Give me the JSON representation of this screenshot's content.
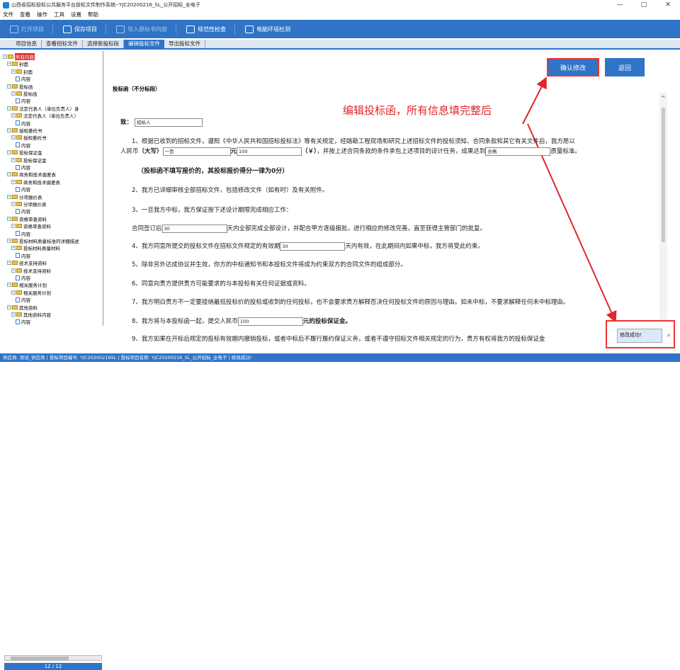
{
  "window": {
    "title": "山西省招标投标公共服务平台投标文件制作系统--YJC20200216_SL_公开招标_全电子",
    "min": "—",
    "max": "□",
    "close": "✕"
  },
  "menu": [
    "文件",
    "查看",
    "操作",
    "工具",
    "设置",
    "帮助"
  ],
  "toolbar": [
    {
      "label": "打开项目",
      "enabled": false,
      "icon": "folder-open-icon"
    },
    {
      "label": "保存项目",
      "enabled": true,
      "icon": "save-icon"
    },
    {
      "label": "导入原标书内容",
      "enabled": false,
      "icon": "import-icon"
    },
    {
      "label": "规范性检查",
      "enabled": true,
      "icon": "check-document-icon"
    },
    {
      "label": "电脑环境检测",
      "enabled": true,
      "icon": "monitor-icon"
    }
  ],
  "tabs": [
    {
      "label": "项目信息",
      "active": false
    },
    {
      "label": "查看招标文件",
      "active": false
    },
    {
      "label": "选择新投标段",
      "active": false
    },
    {
      "label": "编辑投标文件",
      "active": true
    },
    {
      "label": "导出投标文件",
      "active": false
    }
  ],
  "tree": [
    {
      "label": "所有内容",
      "level": 0,
      "type": "folder",
      "selected": true
    },
    {
      "label": "封面",
      "level": 1,
      "type": "folder"
    },
    {
      "label": "封面",
      "level": 2,
      "type": "folder"
    },
    {
      "label": "内容",
      "level": 3,
      "type": "doc"
    },
    {
      "label": "投标函",
      "level": 1,
      "type": "folder"
    },
    {
      "label": "投标函",
      "level": 2,
      "type": "folder"
    },
    {
      "label": "内容",
      "level": 3,
      "type": "doc"
    },
    {
      "label": "法定代表人（单位负责人）身",
      "level": 1,
      "type": "folder"
    },
    {
      "label": "法定代表人（单位负责人）",
      "level": 2,
      "type": "folder"
    },
    {
      "label": "内容",
      "level": 3,
      "type": "doc"
    },
    {
      "label": "授权委托书",
      "level": 1,
      "type": "folder"
    },
    {
      "label": "授权委托书",
      "level": 2,
      "type": "folder"
    },
    {
      "label": "内容",
      "level": 3,
      "type": "doc"
    },
    {
      "label": "投标保证金",
      "level": 1,
      "type": "folder"
    },
    {
      "label": "投标保证金",
      "level": 2,
      "type": "folder"
    },
    {
      "label": "内容",
      "level": 3,
      "type": "doc"
    },
    {
      "label": "商务和技术偏差表",
      "level": 1,
      "type": "folder"
    },
    {
      "label": "商务和技术偏差表",
      "level": 2,
      "type": "folder"
    },
    {
      "label": "内容",
      "level": 3,
      "type": "doc"
    },
    {
      "label": "分项报价表",
      "level": 1,
      "type": "folder"
    },
    {
      "label": "分项报价表",
      "level": 2,
      "type": "folder"
    },
    {
      "label": "内容",
      "level": 3,
      "type": "doc"
    },
    {
      "label": "资格审查资料",
      "level": 1,
      "type": "folder"
    },
    {
      "label": "资格审查资料",
      "level": 2,
      "type": "folder"
    },
    {
      "label": "内容",
      "level": 3,
      "type": "doc"
    },
    {
      "label": "投标材料质量标准的详细描述",
      "level": 1,
      "type": "folder"
    },
    {
      "label": "投标材料质量材料",
      "level": 2,
      "type": "folder"
    },
    {
      "label": "内容",
      "level": 3,
      "type": "doc"
    },
    {
      "label": "技术支持资料",
      "level": 1,
      "type": "folder"
    },
    {
      "label": "技术支持资料",
      "level": 2,
      "type": "folder"
    },
    {
      "label": "内容",
      "level": 3,
      "type": "doc"
    },
    {
      "label": "相关服务计划",
      "level": 1,
      "type": "folder"
    },
    {
      "label": "相关服务计划",
      "level": 2,
      "type": "folder"
    },
    {
      "label": "内容",
      "level": 3,
      "type": "doc"
    },
    {
      "label": "其他资料",
      "level": 1,
      "type": "folder"
    },
    {
      "label": "其他资料内容",
      "level": 2,
      "type": "folder"
    },
    {
      "label": "内容",
      "level": 3,
      "type": "doc"
    }
  ],
  "pager": "12 / 12",
  "buttons": {
    "confirm": "确认修改",
    "back": "返回"
  },
  "annotation": "编辑投标函，所有信息填完整后",
  "doc": {
    "title": "投标函（不分标段）",
    "to_label": "致：",
    "to_value": "招标人",
    "p1a": "1、根据已收到的招标文件，遵照《中华人民共和国招标投标法》等有关规定，经踏勘工程现场和研究上述招标文件的投标须知、合同条款和其它有关文件后，我方愿以",
    "p1b_prefix": "人民币",
    "p1b_caps_label": "（大写）",
    "p1b_caps_value": "一百",
    "p1b_yuan": "元",
    "p1b_num_value": "100",
    "p1b_y": "（￥）",
    "p1b_mid": "，并按上述合同条款的条件承包上述项目的设计任务，成果达到",
    "p1b_quality_value": "合格",
    "p1b_end": "质量标准。",
    "note": "（投标函不填写报价的，其投标报价得分一律为0分）",
    "p2": "2、我方已详细审核全部招标文件，包括修改文件（如有时）及有关附件。",
    "p3": "3、一旦我方中标，我方保证按下述设计期限完成相应工作：",
    "p3b_prefix": "合同签订后",
    "p3b_value": "30",
    "p3b_suffix": "天内全部完成全部设计，并配合甲方逐级报批，进行相应的修改完善，直至获得主管部门的批复。",
    "p4_prefix": "4、我方同意所提交的投标文件在招标文件规定的有效期",
    "p4_value": "30",
    "p4_suffix": "天内有效，在此期间内如果中标，我方将受此约束。",
    "p5": "5、除非另外达成协议并生效，你方的中标通知书和本投标文件将成为约束双方的合同文件的组成部分。",
    "p6": "6、同意向贵方提供贵方可能要求的与本投标有关任何证据或资料。",
    "p7": "7、我方明白贵方不一定要接纳最低投标价的投标或收到的任何投标，也不会要求贵方解释否决任何投标文件的原因与理由。如未中标，不要求解释任何未中标理由。",
    "p8_prefix": "8、我方将与本投标函一起，提交人民币",
    "p8_value": "100",
    "p8_suffix": "元的投标保证金。",
    "p9": "9、我方如果在开标后规定的投标有效期内撤销投标，或者中标后不履行履约保证义务，或者不遵守招标文件相关规定的行为，贵方有权将我方的投标保证金"
  },
  "toast": {
    "text": "修改成功!",
    "close": "✕"
  },
  "status": "供应商: 测试_供应商 | 投标项目编号: YJC20200216SL | 投标项目名称: YJC20200216_SL_公开招标_全电子 | 修改成功!",
  "colors": {
    "toolbar": "#2f74c7",
    "annotation": "#e0262b",
    "highlight": "#d33"
  }
}
